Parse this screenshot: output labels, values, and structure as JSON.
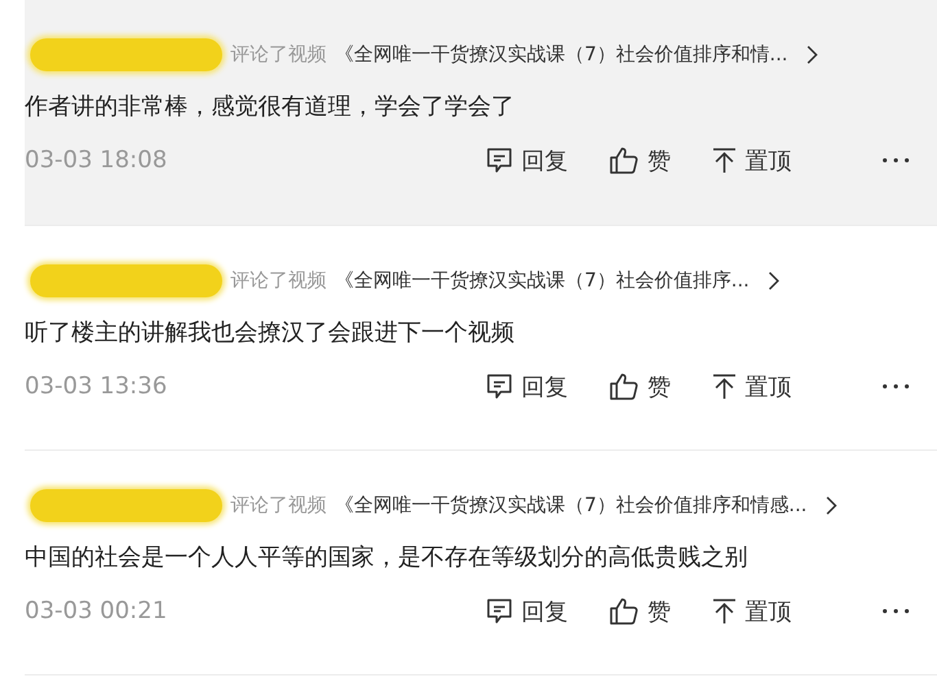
{
  "comments": [
    {
      "highlighted": true,
      "action_text": "评论了视频",
      "video_title": "《全网唯一干货撩汉实战课（7）社会价值排序和情...",
      "content": "作者讲的非常棒，感觉很有道理，学会了学会了",
      "time": "03-03 18:08",
      "actions": [
        {
          "kind": "reply",
          "label": "回复"
        },
        {
          "kind": "like",
          "label": "赞"
        },
        {
          "kind": "pin",
          "label": "置顶"
        }
      ]
    },
    {
      "highlighted": false,
      "action_text": "评论了视频",
      "video_title": "《全网唯一干货撩汉实战课（7）社会价值排序...",
      "content": "听了楼主的讲解我也会撩汉了会跟进下一个视频",
      "time": "03-03 13:36",
      "actions": [
        {
          "kind": "reply",
          "label": "回复"
        },
        {
          "kind": "like",
          "label": "赞"
        },
        {
          "kind": "pin",
          "label": "置顶"
        }
      ]
    },
    {
      "highlighted": false,
      "action_text": "评论了视频",
      "video_title": "《全网唯一干货撩汉实战课（7）社会价值排序和情感...",
      "content": "中国的社会是一个人人平等的国家，是不存在等级划分的高低贵贱之别",
      "time": "03-03 00:21",
      "actions": [
        {
          "kind": "reply",
          "label": "回复"
        },
        {
          "kind": "like",
          "label": "赞"
        },
        {
          "kind": "pin",
          "label": "置顶"
        }
      ]
    }
  ]
}
